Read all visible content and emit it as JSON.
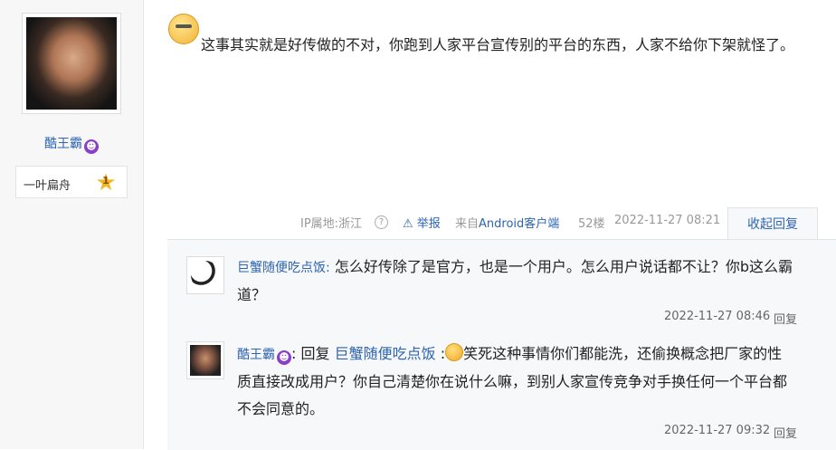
{
  "author": {
    "name": "酷王霸",
    "badge_label": "一叶扁舟",
    "badge_level": "1"
  },
  "post": {
    "text": "这事其实就是好传做的不对，你跑到人家平台宣传别的平台的东西，人家不给你下架就怪了。",
    "ip": "IP属地:浙江",
    "report_label": "举报",
    "source_prefix": "来自",
    "source_link": "Android客户端",
    "floor": "52楼",
    "time": "2022-11-27 08:21",
    "collapse_label": "收起回复"
  },
  "replies": [
    {
      "user": "巨蟹随便吃点饭:",
      "text": "怎么好传除了是官方，也是一个用户。怎么用户说话都不让？你b这么霸道？",
      "time": "2022-11-27 08:46",
      "reply_label": "回复",
      "avatar_icon": "soccer-ball-icon"
    },
    {
      "user": "酷王霸",
      "reply_word": ":  回复",
      "target": "巨蟹随便吃点饭",
      "colon": ":",
      "text": "笑死这种事情你们都能洗，还偷换概念把厂家的性质直接改成用户？你自己清楚你在说什么嘛，到别人家宣传竞争对手换任何一个平台都不会同意的。",
      "time": "2022-11-27 09:32",
      "reply_label": "回复",
      "avatar_icon": "portrait-icon"
    }
  ],
  "colors": {
    "link": "#2d64b3",
    "sidebar_bg": "#f7f7f7",
    "reply_bg": "#f7f8fa"
  }
}
